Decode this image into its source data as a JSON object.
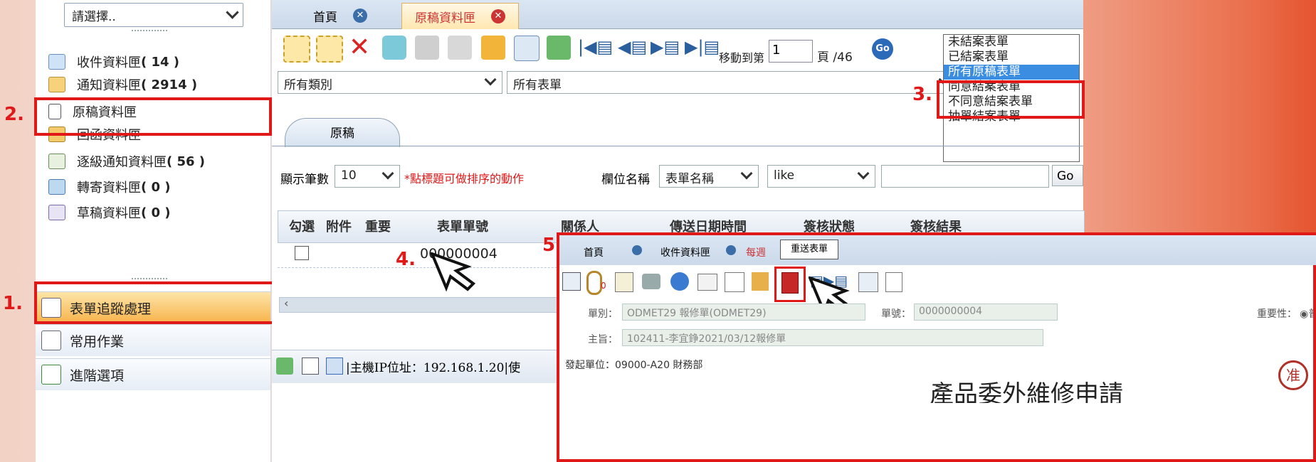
{
  "sidebar": {
    "select_value": "請選擇..",
    "items": [
      {
        "label": "收件資料匣",
        "count": "( 14 )"
      },
      {
        "label": "通知資料匣",
        "count": "( 2914 )"
      },
      {
        "label": "原稿資料匣",
        "count": ""
      },
      {
        "label": "回函資料匣",
        "count": ""
      },
      {
        "label": "逐級通知資料匣",
        "count": "( 56 )"
      },
      {
        "label": "轉寄資料匣",
        "count": "( 0 )"
      },
      {
        "label": "草稿資料匣",
        "count": "( 0 )"
      }
    ],
    "bottom": [
      {
        "label": "表單追蹤處理"
      },
      {
        "label": "常用作業"
      },
      {
        "label": "進階選項"
      }
    ]
  },
  "tabs": [
    {
      "label": "首頁"
    },
    {
      "label": "原稿資料匣"
    }
  ],
  "toolbar": {
    "goto_prefix": "移動到第",
    "page_value": "1",
    "page_suffix": "頁 /46",
    "go_label": "Go"
  },
  "filters": {
    "category": "所有類別",
    "form": "所有表單",
    "list_options": [
      "未結案表單",
      "已結案表單",
      "所有原稿表單",
      "同意結案表單",
      "不同意結案表單",
      "抽單結案表單"
    ],
    "selected_index": 2
  },
  "subtab": "原稿",
  "search": {
    "rows_label": "顯示筆數",
    "rows_value": "10",
    "hint": "*點標題可做排序的動作",
    "field_label": "欄位名稱",
    "field_value": "表單名稱",
    "op_value": "like",
    "go_label": "Go"
  },
  "table": {
    "headers": [
      "勾選",
      "附件",
      "重要",
      "表單單號",
      "關係人",
      "傳送日期時間",
      "簽核狀態",
      "簽核結果"
    ],
    "row_number": "000000004"
  },
  "status_bar": "|主機IP位址：192.168.1.20|使",
  "steps": [
    "1.",
    "2.",
    "3.",
    "4.",
    "5"
  ],
  "inset": {
    "tabs": [
      "首頁",
      "收件資料匣",
      "每週",
      "重送表單"
    ],
    "badge_count": "0",
    "type_label": "單別：",
    "type_value": "ODMET29 報修單(ODMET29)",
    "num_label": "單號：",
    "num_value": "0000000004",
    "priority_label": "重要性：",
    "priority_value": "普",
    "subject_label": "主旨：",
    "subject_value": "102411-李宜錚2021/03/12報修單",
    "dept": "發起單位：09000-A20 財務部",
    "doc_title": "產品委外維修申請",
    "stamp": "准"
  },
  "colors": {
    "accent_red": "#e01818",
    "selected_blue": "#3a8de0",
    "active_orange": "#f7b24a"
  }
}
